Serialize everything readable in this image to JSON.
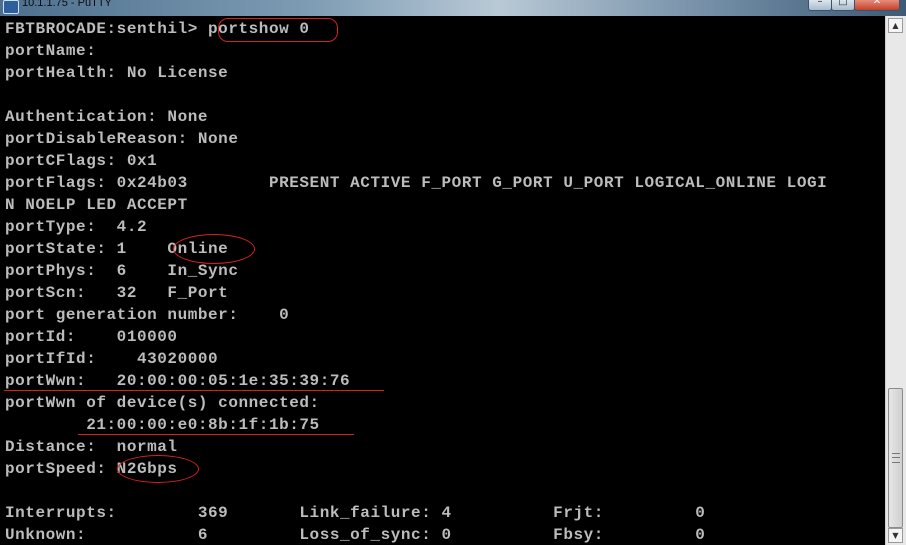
{
  "window": {
    "title": "10.1.1.75 - PuTTY",
    "minimize_glyph": "–",
    "maximize_glyph": "□",
    "close_glyph": "✕",
    "app_icon": "putty-icon"
  },
  "terminal": {
    "lines": [
      "FBTBROCADE:senthil> portshow 0",
      "portName:",
      "portHealth: No License",
      "",
      "Authentication: None",
      "portDisableReason: None",
      "portCFlags: 0x1",
      "portFlags: 0x24b03        PRESENT ACTIVE F_PORT G_PORT U_PORT LOGICAL_ONLINE LOGI",
      "N NOELP LED ACCEPT",
      "portType:  4.2",
      "portState: 1    Online",
      "portPhys:  6    In_Sync",
      "portScn:   32   F_Port",
      "port generation number:    0",
      "portId:    010000",
      "portIfId:    43020000",
      "portWwn:   20:00:00:05:1e:35:39:76",
      "portWwn of device(s) connected:",
      "        21:00:00:e0:8b:1f:1b:75",
      "Distance:  normal",
      "portSpeed: N2Gbps",
      "",
      "Interrupts:        369       Link_failure: 4          Frjt:         0",
      "Unknown:           6         Loss_of_sync: 0          Fbsy:         0"
    ]
  },
  "scrollbar": {
    "up_arrow": "▲",
    "down_arrow": "▼",
    "position_fraction": 0.82
  },
  "annotation_color": "#d82020"
}
